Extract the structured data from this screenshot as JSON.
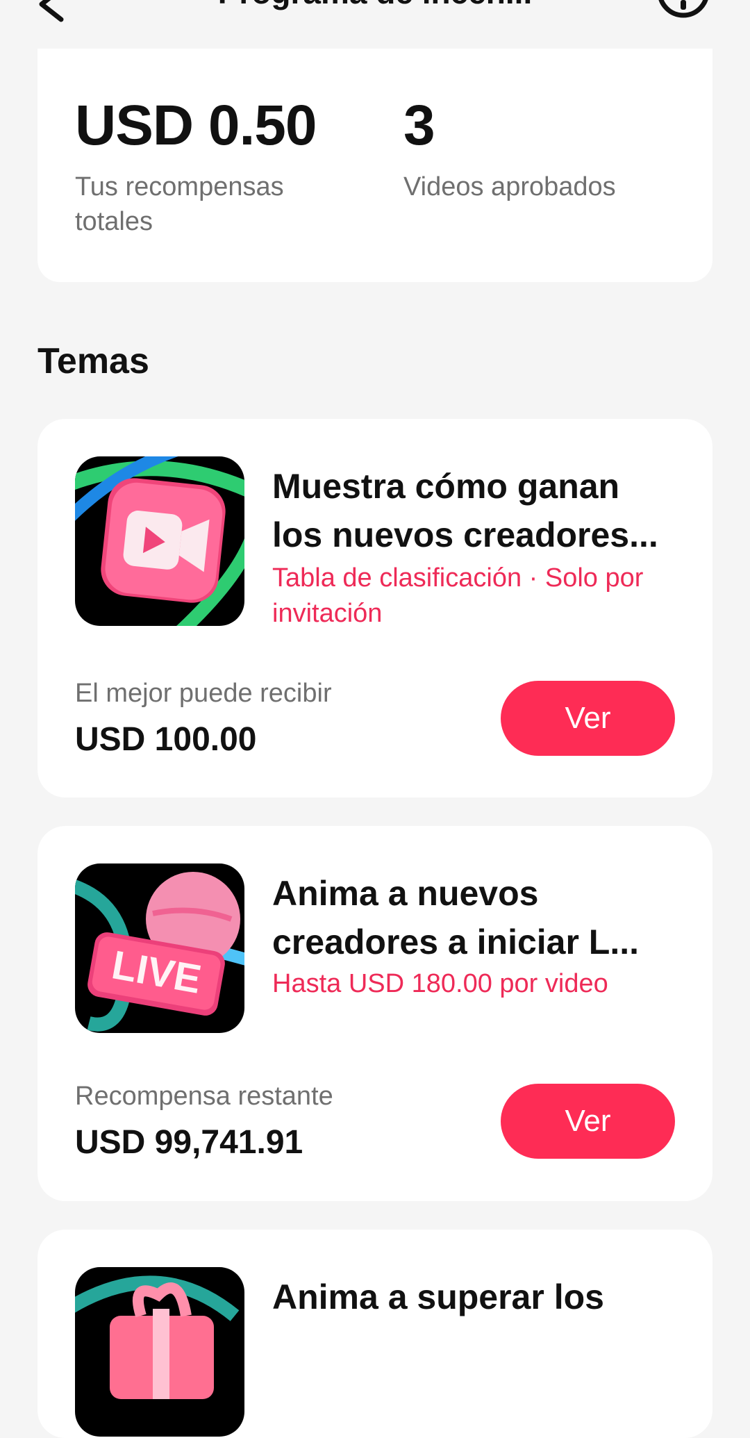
{
  "header": {
    "title": "Programa de incen...",
    "back_icon": "back-arrow-icon",
    "info_icon": "info-icon"
  },
  "summary": {
    "total_rewards_value": "USD 0.50",
    "total_rewards_label": "Tus recompensas totales",
    "approved_videos_value": "3",
    "approved_videos_label": "Videos aprobados"
  },
  "section_title": "Temas",
  "topics": [
    {
      "title_line1": "Muestra cómo ganan",
      "title_line2": "los nuevos creadores...",
      "subtitle": "Tabla de clasificación · Solo por invitación",
      "reward_label": "El mejor puede recibir",
      "reward_value": "USD 100.00",
      "button_label": "Ver",
      "icon": "video-camera-icon"
    },
    {
      "title_line1": "Anima a nuevos",
      "title_line2": "creadores a iniciar L...",
      "subtitle": "Hasta USD 180.00 por video",
      "reward_label": "Recompensa restante",
      "reward_value": "USD 99,741.91",
      "button_label": "Ver",
      "icon": "live-badge-icon",
      "icon_text": "LIVE"
    },
    {
      "title_line1": "Anima a superar los",
      "title_line2": "",
      "icon": "gift-icon"
    }
  ],
  "colors": {
    "accent": "#FE2C55",
    "accent_text": "#EE2A57",
    "background": "#F5F5F5",
    "card": "#FFFFFF"
  }
}
